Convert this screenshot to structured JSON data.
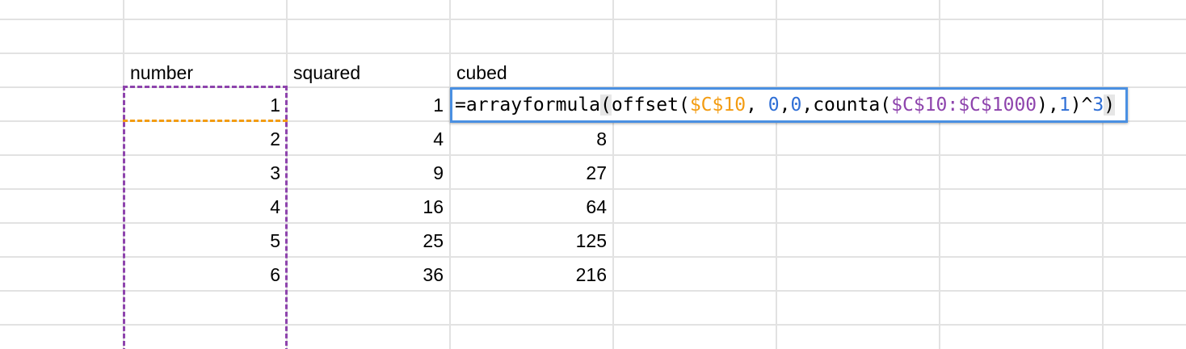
{
  "sheet": {
    "headers": {
      "number": "number",
      "squared": "squared",
      "cubed": "cubed"
    },
    "number_values": [
      "1",
      "2",
      "3",
      "4",
      "5",
      "6"
    ],
    "squared_values": [
      "1",
      "4",
      "9",
      "16",
      "25",
      "36"
    ],
    "cubed_values": [
      "8",
      "27",
      "64",
      "125",
      "216"
    ]
  },
  "formula": {
    "tokens": [
      {
        "text": "=arrayformula",
        "color": "#000000"
      },
      {
        "text": "(",
        "color": "#000000",
        "highlight": true
      },
      {
        "text": "offset(",
        "color": "#000000"
      },
      {
        "text": "$C$10",
        "color": "#f39c12"
      },
      {
        "text": ", ",
        "color": "#000000"
      },
      {
        "text": "0",
        "color": "#2f6fd6"
      },
      {
        "text": ",",
        "color": "#000000"
      },
      {
        "text": "0",
        "color": "#2f6fd6"
      },
      {
        "text": ",counta(",
        "color": "#000000"
      },
      {
        "text": "$C$10:$C$1000",
        "color": "#8e44ad"
      },
      {
        "text": "),",
        "color": "#000000"
      },
      {
        "text": "1",
        "color": "#2f6fd6"
      },
      {
        "text": ")^",
        "color": "#000000"
      },
      {
        "text": "3",
        "color": "#2f6fd6"
      },
      {
        "text": ")",
        "color": "#000000",
        "highlight": true
      }
    ]
  },
  "colors": {
    "grid": "#e2e2e2",
    "copy_range": "#8e44ad",
    "reference_range": "#f39c12",
    "active_cell": "#4a90e2"
  }
}
